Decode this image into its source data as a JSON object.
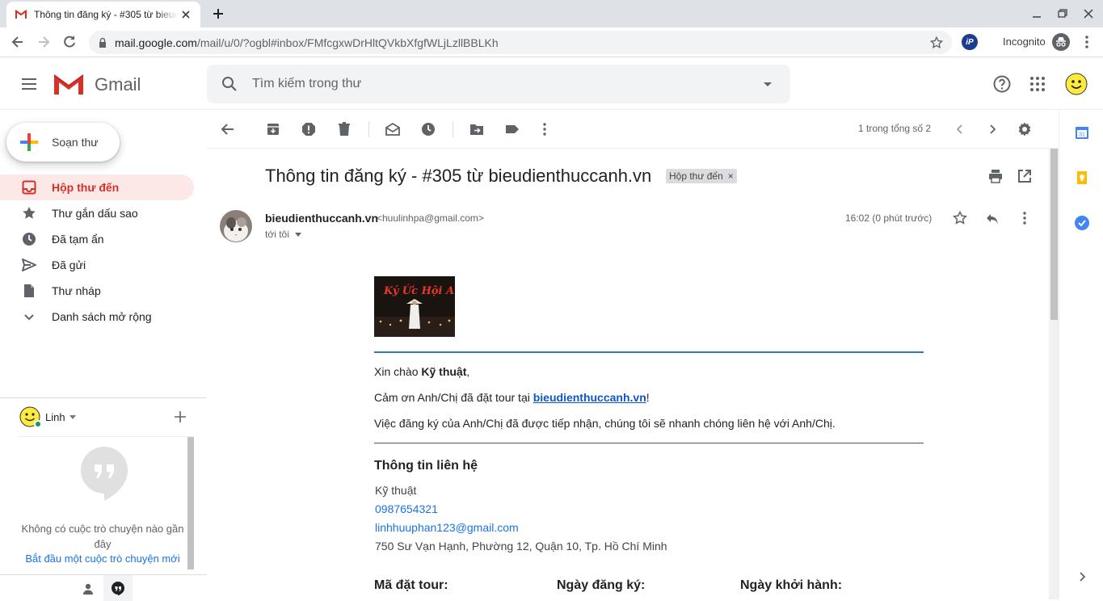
{
  "browser": {
    "tab_title": "Thông tin đăng ký - #305 từ bieudienthuccanh.vn",
    "url_host": "mail.google.com",
    "url_path": "/mail/u/0/?ogbl#inbox/FMfcgxwDrHltQVkbXfgfWLjLzllBBLKh",
    "incognito_label": "Incognito"
  },
  "gmail": {
    "product_name": "Gmail",
    "search_placeholder": "Tìm kiếm trong thư"
  },
  "nav": {
    "compose_label": "Soạn thư",
    "items": [
      {
        "label": "Hộp thư đến",
        "icon": "inbox-icon",
        "active": true
      },
      {
        "label": "Thư gắn dấu sao",
        "icon": "star-icon"
      },
      {
        "label": "Đã tạm ẩn",
        "icon": "clock-icon"
      },
      {
        "label": "Đã gửi",
        "icon": "send-icon"
      },
      {
        "label": "Thư nháp",
        "icon": "draft-icon"
      },
      {
        "label": "Danh sách mở rộng",
        "icon": "chevron-down-icon"
      }
    ]
  },
  "hangouts": {
    "user_name": "Linh",
    "empty_text": "Không có cuộc trò chuyện nào gần đây",
    "start_link": "Bắt đầu một cuộc trò chuyện mới"
  },
  "toolbar": {
    "pager": "1 trong tổng số 2"
  },
  "message": {
    "subject": "Thông tin đăng ký - #305 từ bieudienthuccanh.vn",
    "label_chip": "Hộp thư đến",
    "sender_name": "bieudienthuccanh.vn",
    "sender_email": "<huulinhpa@gmail.com>",
    "to": "tới tôi",
    "time": "16:02 (0 phút trước)",
    "banner_title": "Ký Ức Hội An",
    "greeting_prefix": "Xin chào ",
    "greeting_name": "Kỹ thuật",
    "greeting_suffix": ",",
    "thanks_prefix": "Cảm ơn Anh/Chị đã đặt tour tại ",
    "thanks_link": "bieudienthuccanh.vn",
    "thanks_suffix": "!",
    "received_text": "Việc đăng ký của Anh/Chị đã được tiếp nhận, chúng tôi sẽ nhanh chóng liên hệ với Anh/Chị.",
    "contact_heading": "Thông tin liên hệ",
    "contact_name": "Kỹ thuật",
    "contact_phone": "0987654321",
    "contact_email": "linhhuuphan123@gmail.com",
    "contact_address": "750 Sư Vạn Hạnh, Phường 12, Quận 10, Tp. Hồ Chí Minh",
    "col_booking_code": "Mã đặt tour:",
    "col_register_date": "Ngày đăng ký:",
    "col_start_date": "Ngày khởi hành:"
  },
  "colors": {
    "gmail_red": "#d93025",
    "link_blue": "#1a73e8",
    "active_nav_bg": "#fce8e6",
    "rule_blue": "#2f7fa8"
  }
}
